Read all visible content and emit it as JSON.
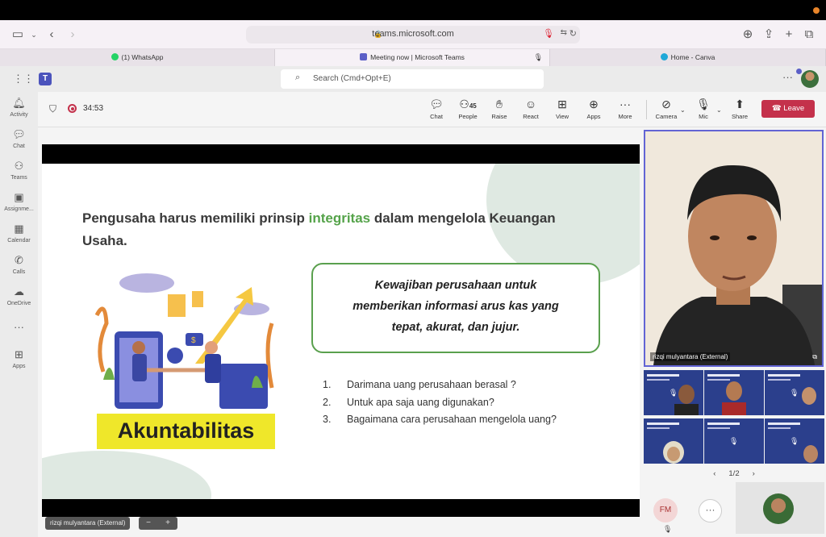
{
  "browser": {
    "url": "teams.microsoft.com",
    "tabs": [
      {
        "label": "(1) WhatsApp",
        "active": false
      },
      {
        "label": "Meeting now | Microsoft Teams",
        "active": true
      },
      {
        "label": "Home - Canva",
        "active": false
      }
    ]
  },
  "teams": {
    "search_placeholder": "Search (Cmd+Opt+E)",
    "rail": [
      "Activity",
      "Chat",
      "Teams",
      "Assignme...",
      "Calendar",
      "Calls",
      "OneDrive",
      "Apps"
    ]
  },
  "meeting": {
    "timer": "34:53",
    "participant_count": "45",
    "controls": [
      "Chat",
      "People",
      "Raise",
      "React",
      "View",
      "Apps",
      "More",
      "Camera",
      "Mic",
      "Share"
    ],
    "leave_label": "Leave",
    "presenter_tag": "rizqi mulyantara (External)",
    "zoom_minus": "−",
    "zoom_plus": "+"
  },
  "slide": {
    "heading_pre": "Pengusaha harus memiliki prinsip ",
    "heading_highlight": "integritas",
    "heading_post": " dalam mengelola Keuangan Usaha.",
    "callout_line1": "Kewajiban perusahaan untuk",
    "callout_line2": "memberikan informasi arus kas  yang",
    "callout_line3": "tepat, akurat, dan jujur.",
    "questions": [
      {
        "num": "1.",
        "text": "Darimana uang perusahaan berasal ?"
      },
      {
        "num": "2.",
        "text": "Untuk apa saja uang digunakan?"
      },
      {
        "num": "3.",
        "text": "Bagaimana cara perusahaan mengelola uang?"
      }
    ],
    "badge": "Akuntabilitas"
  },
  "participants": {
    "speaker_label": "rizqi mulyantara (External)",
    "pager": "1/2",
    "initials": "FM"
  },
  "colors": {
    "teams_purple": "#5b5fc7",
    "leave_red": "#c4314b",
    "slide_green": "#55a34a",
    "badge_yellow": "#efe72a"
  }
}
